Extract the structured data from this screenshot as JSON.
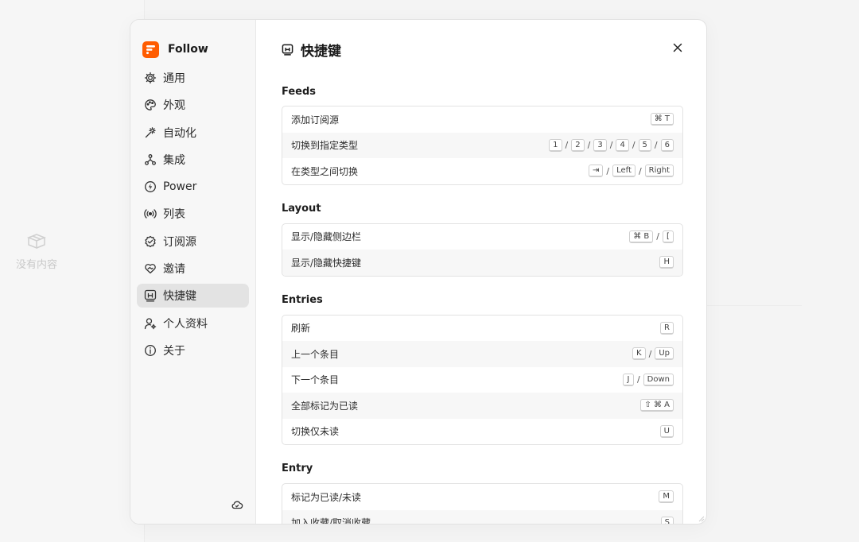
{
  "background": {
    "empty_state_text": "没有内容"
  },
  "brand": {
    "name": "Follow",
    "accent": "#ff5c00"
  },
  "sidebar": {
    "items": [
      {
        "label": "通用",
        "icon": "gear-icon",
        "active": false
      },
      {
        "label": "外观",
        "icon": "palette-icon",
        "active": false
      },
      {
        "label": "自动化",
        "icon": "magic-wand-icon",
        "active": false
      },
      {
        "label": "集成",
        "icon": "integration-icon",
        "active": false
      },
      {
        "label": "Power",
        "icon": "power-bolt-icon",
        "active": false
      },
      {
        "label": "列表",
        "icon": "broadcast-icon",
        "active": false
      },
      {
        "label": "订阅源",
        "icon": "verified-check-icon",
        "active": false
      },
      {
        "label": "邀请",
        "icon": "handshake-heart-icon",
        "active": false
      },
      {
        "label": "快捷键",
        "icon": "keyboard-shortcut-icon",
        "active": true
      },
      {
        "label": "个人资料",
        "icon": "user-settings-icon",
        "active": false
      },
      {
        "label": "关于",
        "icon": "info-icon",
        "active": false
      }
    ]
  },
  "page": {
    "title": "快捷键",
    "close_icon": "close-icon"
  },
  "sections": [
    {
      "title": "Feeds",
      "rows": [
        {
          "label": "添加订阅源",
          "keys": [
            [
              "⌘ T"
            ]
          ]
        },
        {
          "label": "切换到指定类型",
          "keys": [
            [
              "1"
            ],
            [
              "2"
            ],
            [
              "3"
            ],
            [
              "4"
            ],
            [
              "5"
            ],
            [
              "6"
            ]
          ]
        },
        {
          "label": "在类型之间切换",
          "keys": [
            [
              "⇥"
            ],
            [
              "Left"
            ],
            [
              "Right"
            ]
          ]
        }
      ]
    },
    {
      "title": "Layout",
      "rows": [
        {
          "label": "显示/隐藏侧边栏",
          "keys": [
            [
              "⌘ B"
            ],
            [
              "["
            ]
          ]
        },
        {
          "label": "显示/隐藏快捷键",
          "keys": [
            [
              "H"
            ]
          ]
        }
      ]
    },
    {
      "title": "Entries",
      "rows": [
        {
          "label": "刷新",
          "keys": [
            [
              "R"
            ]
          ]
        },
        {
          "label": "上一个条目",
          "keys": [
            [
              "K"
            ],
            [
              "Up"
            ]
          ]
        },
        {
          "label": "下一个条目",
          "keys": [
            [
              "J"
            ],
            [
              "Down"
            ]
          ]
        },
        {
          "label": "全部标记为已读",
          "keys": [
            [
              "⇧ ⌘ A"
            ]
          ]
        },
        {
          "label": "切换仅未读",
          "keys": [
            [
              "U"
            ]
          ]
        }
      ]
    },
    {
      "title": "Entry",
      "rows": [
        {
          "label": "标记为已读/未读",
          "keys": [
            [
              "M"
            ]
          ]
        },
        {
          "label": "加入收藏/取消收藏",
          "keys": [
            [
              "S"
            ]
          ]
        }
      ]
    }
  ]
}
